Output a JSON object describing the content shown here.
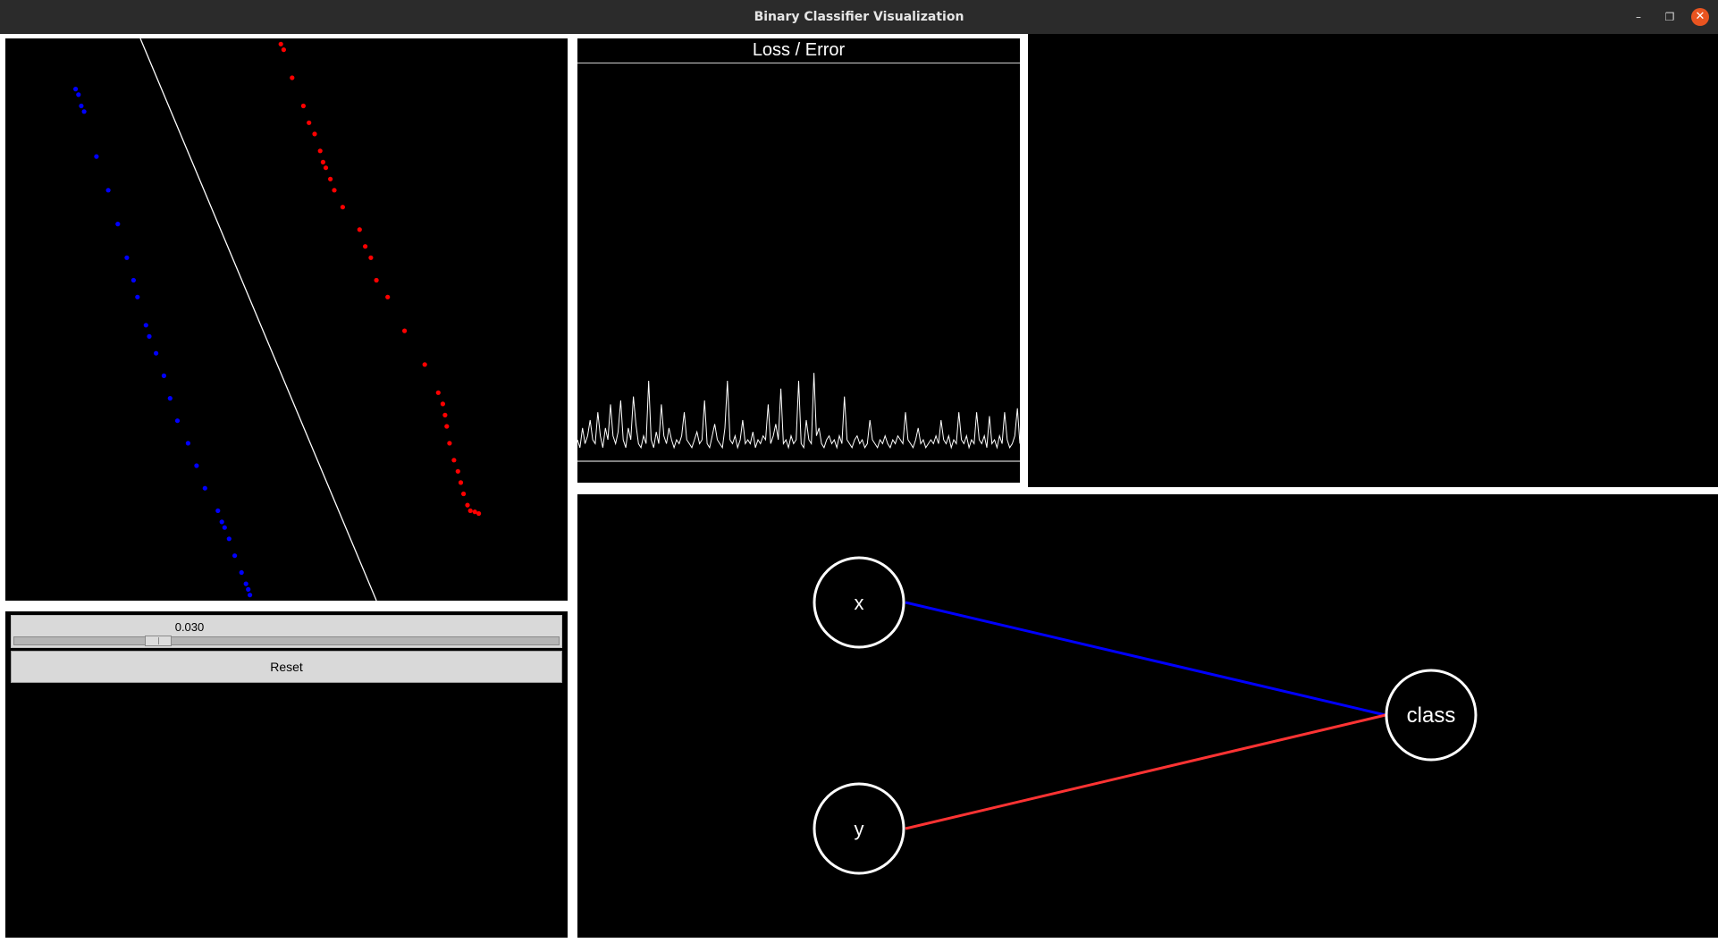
{
  "window": {
    "title": "Binary Classifier Visualization",
    "minimize_glyph": "–",
    "maximize_glyph": "❐",
    "close_glyph": "✕"
  },
  "controls": {
    "slider_value": "0.030",
    "slider_fraction": 0.3,
    "reset_label": "Reset"
  },
  "loss_chart": {
    "title": "Loss / Error"
  },
  "network": {
    "input_nodes": [
      "x",
      "y"
    ],
    "output_node": "class",
    "edge_colors": {
      "x_to_class": "#0000ff",
      "y_to_class": "#ff3333"
    }
  },
  "colors": {
    "class_a": "#0000ff",
    "class_b": "#ff0000",
    "boundary": "#ffffff",
    "background": "#000000",
    "accent": "#e95420"
  },
  "chart_data": [
    {
      "type": "scatter",
      "series": [
        {
          "color": "#0000ff",
          "points": [
            [
              0.125,
              0.09
            ],
            [
              0.13,
              0.1
            ],
            [
              0.135,
              0.12
            ],
            [
              0.14,
              0.13
            ],
            [
              0.162,
              0.21
            ],
            [
              0.183,
              0.27
            ],
            [
              0.2,
              0.33
            ],
            [
              0.216,
              0.39
            ],
            [
              0.228,
              0.43
            ],
            [
              0.235,
              0.46
            ],
            [
              0.25,
              0.51
            ],
            [
              0.256,
              0.53
            ],
            [
              0.268,
              0.56
            ],
            [
              0.282,
              0.6
            ],
            [
              0.293,
              0.64
            ],
            [
              0.306,
              0.68
            ],
            [
              0.325,
              0.72
            ],
            [
              0.34,
              0.76
            ],
            [
              0.355,
              0.8
            ],
            [
              0.378,
              0.84
            ],
            [
              0.385,
              0.86
            ],
            [
              0.39,
              0.87
            ],
            [
              0.398,
              0.89
            ],
            [
              0.408,
              0.92
            ],
            [
              0.42,
              0.95
            ],
            [
              0.428,
              0.97
            ],
            [
              0.432,
              0.98
            ],
            [
              0.435,
              0.99
            ]
          ]
        },
        {
          "color": "#ff0000",
          "points": [
            [
              0.49,
              0.01
            ],
            [
              0.495,
              0.02
            ],
            [
              0.51,
              0.07
            ],
            [
              0.53,
              0.12
            ],
            [
              0.54,
              0.15
            ],
            [
              0.55,
              0.17
            ],
            [
              0.56,
              0.2
            ],
            [
              0.565,
              0.22
            ],
            [
              0.57,
              0.23
            ],
            [
              0.578,
              0.25
            ],
            [
              0.585,
              0.27
            ],
            [
              0.6,
              0.3
            ],
            [
              0.63,
              0.34
            ],
            [
              0.64,
              0.37
            ],
            [
              0.65,
              0.39
            ],
            [
              0.66,
              0.43
            ],
            [
              0.68,
              0.46
            ],
            [
              0.71,
              0.52
            ],
            [
              0.746,
              0.58
            ],
            [
              0.77,
              0.63
            ],
            [
              0.778,
              0.65
            ],
            [
              0.782,
              0.67
            ],
            [
              0.785,
              0.69
            ],
            [
              0.79,
              0.72
            ],
            [
              0.798,
              0.75
            ],
            [
              0.805,
              0.77
            ],
            [
              0.81,
              0.79
            ],
            [
              0.815,
              0.81
            ],
            [
              0.822,
              0.83
            ],
            [
              0.827,
              0.84
            ],
            [
              0.835,
              0.842
            ],
            [
              0.842,
              0.845
            ]
          ]
        }
      ],
      "decision_boundary": [
        [
          0.24,
          0.0
        ],
        [
          0.66,
          1.0
        ]
      ]
    },
    {
      "type": "line",
      "title": "Loss / Error",
      "values": [
        0.05,
        0.03,
        0.08,
        0.04,
        0.06,
        0.1,
        0.05,
        0.04,
        0.12,
        0.06,
        0.03,
        0.08,
        0.05,
        0.14,
        0.06,
        0.04,
        0.07,
        0.15,
        0.05,
        0.03,
        0.08,
        0.05,
        0.16,
        0.09,
        0.04,
        0.03,
        0.06,
        0.04,
        0.2,
        0.05,
        0.03,
        0.07,
        0.04,
        0.14,
        0.06,
        0.04,
        0.08,
        0.05,
        0.03,
        0.05,
        0.04,
        0.06,
        0.12,
        0.05,
        0.04,
        0.03,
        0.05,
        0.07,
        0.04,
        0.05,
        0.15,
        0.04,
        0.03,
        0.06,
        0.09,
        0.05,
        0.04,
        0.03,
        0.08,
        0.2,
        0.05,
        0.04,
        0.06,
        0.03,
        0.05,
        0.1,
        0.04,
        0.05,
        0.04,
        0.07,
        0.03,
        0.05,
        0.04,
        0.06,
        0.05,
        0.14,
        0.04,
        0.06,
        0.09,
        0.05,
        0.18,
        0.04,
        0.05,
        0.03,
        0.06,
        0.04,
        0.05,
        0.2,
        0.04,
        0.03,
        0.1,
        0.05,
        0.04,
        0.22,
        0.06,
        0.08,
        0.04,
        0.03,
        0.05,
        0.06,
        0.04,
        0.05,
        0.03,
        0.06,
        0.04,
        0.16,
        0.05,
        0.04,
        0.03,
        0.05,
        0.06,
        0.04,
        0.05,
        0.03,
        0.04,
        0.1,
        0.05,
        0.04,
        0.03,
        0.05,
        0.04,
        0.06,
        0.04,
        0.03,
        0.05,
        0.04,
        0.06,
        0.05,
        0.04,
        0.12,
        0.05,
        0.04,
        0.03,
        0.05,
        0.08,
        0.04,
        0.05,
        0.03,
        0.04,
        0.05,
        0.04,
        0.06,
        0.04,
        0.1,
        0.05,
        0.04,
        0.06,
        0.03,
        0.05,
        0.04,
        0.12,
        0.05,
        0.04,
        0.06,
        0.03,
        0.05,
        0.04,
        0.12,
        0.05,
        0.04,
        0.06,
        0.03,
        0.11,
        0.04,
        0.05,
        0.03,
        0.06,
        0.04,
        0.12,
        0.05,
        0.03,
        0.04,
        0.06,
        0.13,
        0.04
      ],
      "ylim": [
        0,
        1
      ]
    }
  ]
}
